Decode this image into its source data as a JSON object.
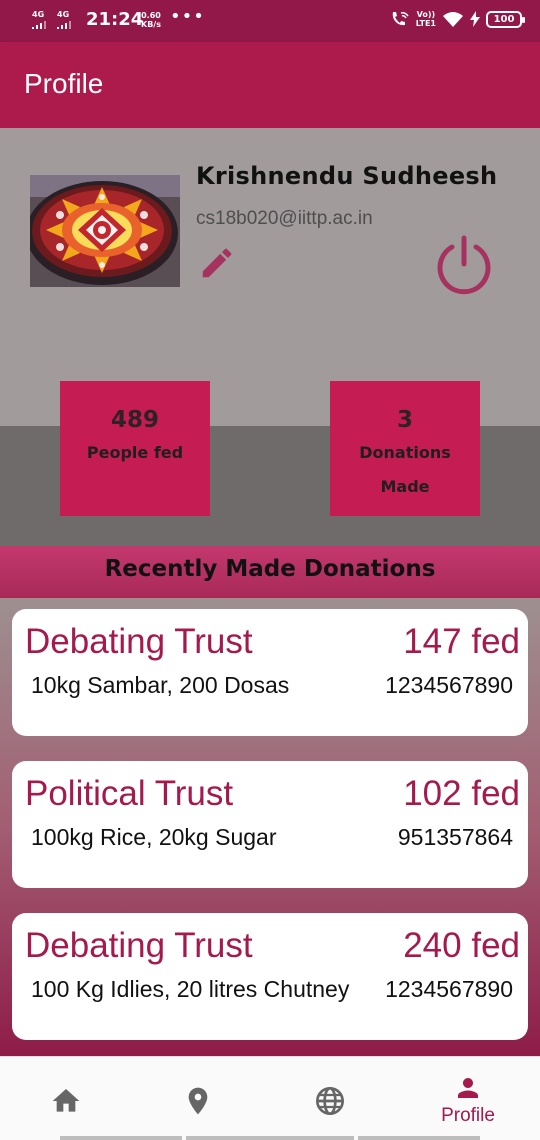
{
  "status_bar": {
    "network_1": "4G",
    "network_2": "4G",
    "time": "21:24",
    "speed_value": "0.60",
    "speed_unit": "KB/s",
    "more": "•••",
    "volte_top": "Vo))",
    "volte_bottom": "LTE1",
    "battery": "100"
  },
  "app_bar": {
    "title": "Profile"
  },
  "profile": {
    "name": "Krishnendu Sudheesh",
    "email": "cs18b020@iittp.ac.in",
    "accent_color": "#a6335f"
  },
  "stats": [
    {
      "value": "489",
      "label_line1": "People fed",
      "label_line2": ""
    },
    {
      "value": "3",
      "label_line1": "Donations",
      "label_line2": "Made"
    }
  ],
  "section": {
    "title": "Recently Made Donations"
  },
  "donations": [
    {
      "trust": "Debating Trust",
      "fed": "147 fed",
      "items": "10kg Sambar,  200 Dosas",
      "phone": "1234567890"
    },
    {
      "trust": "Political Trust",
      "fed": "102 fed",
      "items": "100kg Rice,  20kg Sugar",
      "phone": "951357864"
    },
    {
      "trust": "Debating Trust",
      "fed": "240 fed",
      "items": "100 Kg Idlies,  20 litres Chutney",
      "phone": "1234567890"
    }
  ],
  "bottom_nav": {
    "items": [
      {
        "icon": "home-icon",
        "label": ""
      },
      {
        "icon": "location-pin-icon",
        "label": ""
      },
      {
        "icon": "globe-icon",
        "label": ""
      },
      {
        "icon": "person-icon",
        "label": "Profile"
      }
    ],
    "active_index": 3,
    "active_color": "#a41a4d",
    "inactive_color": "#666666"
  }
}
